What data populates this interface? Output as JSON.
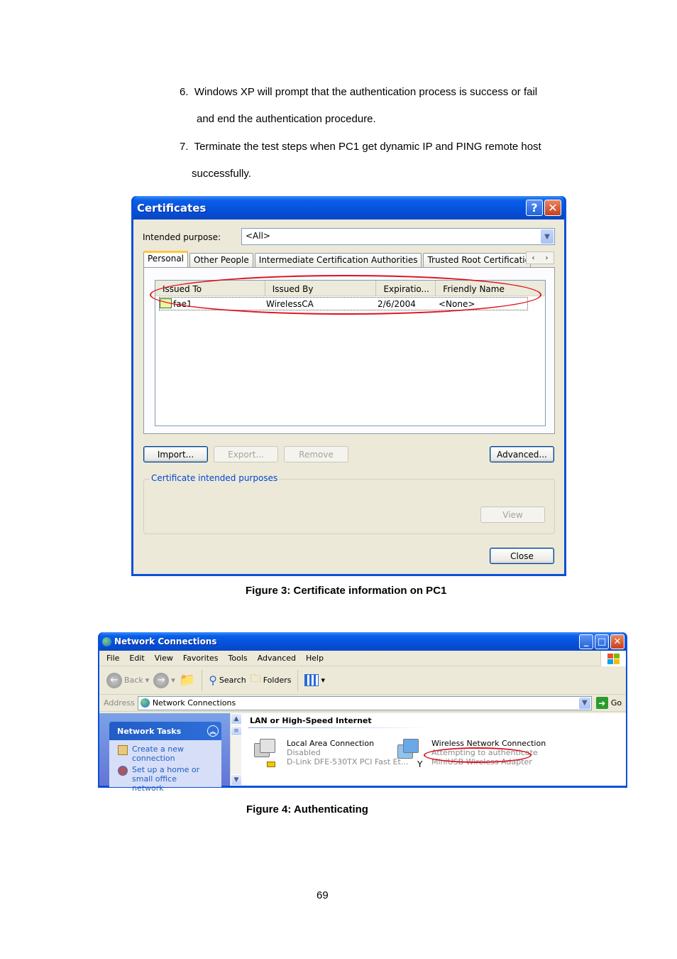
{
  "document": {
    "steps": [
      {
        "number": "6.",
        "line1": "Windows XP will prompt that the authentication process is success or fail",
        "line2": "and end the authentication procedure."
      },
      {
        "number": "7.",
        "line1": "Terminate the test steps when PC1 get dynamic IP and PING remote host",
        "line2": "successfully."
      }
    ],
    "figure3_caption": "Figure 3: Certificate information on PC1",
    "figure4_caption": "Figure 4: Authenticating",
    "page_number": "69"
  },
  "certificates_dialog": {
    "title": "Certificates",
    "help_icon": "?",
    "close_icon": "✕",
    "intended_purpose_label": "Intended purpose:",
    "intended_purpose_value": "<All>",
    "tabs": [
      {
        "label": "Personal",
        "active": true
      },
      {
        "label": "Other People",
        "active": false
      },
      {
        "label": "Intermediate Certification Authorities",
        "active": false
      },
      {
        "label": "Trusted Root Certification",
        "active": false
      }
    ],
    "tab_scroll_left": "‹",
    "tab_scroll_right": "›",
    "columns": [
      "Issued To",
      "Issued By",
      "Expiratio...",
      "Friendly Name"
    ],
    "rows": [
      {
        "issued_to": "fae1",
        "issued_by": "WirelessCA",
        "expiration": "2/6/2004",
        "friendly_name": "<None>"
      }
    ],
    "buttons": {
      "import": "Import...",
      "export": "Export...",
      "remove": "Remove",
      "advanced": "Advanced...",
      "view": "View",
      "close": "Close"
    },
    "group_label": "Certificate intended purposes",
    "highlight_color": "#e0101c"
  },
  "network_connections": {
    "title": "Network Connections",
    "menu": [
      "File",
      "Edit",
      "View",
      "Favorites",
      "Tools",
      "Advanced",
      "Help"
    ],
    "toolbar": {
      "back": "Back",
      "search": "Search",
      "folders": "Folders"
    },
    "address_label": "Address",
    "address_value": "Network Connections",
    "go_label": "Go",
    "task_pane": {
      "title": "Network Tasks",
      "items": [
        "Create a new connection",
        "Set up a home or small office network"
      ]
    },
    "group_title": "LAN or High-Speed Internet",
    "connections": [
      {
        "name": "Local Area Connection",
        "status": "Disabled",
        "device": "D-Link DFE-530TX PCI Fast Et..."
      },
      {
        "name": "Wireless Network Connection",
        "status": "Attempting to authenticate",
        "device": "MiniUSB Wireless Adapter"
      }
    ]
  }
}
